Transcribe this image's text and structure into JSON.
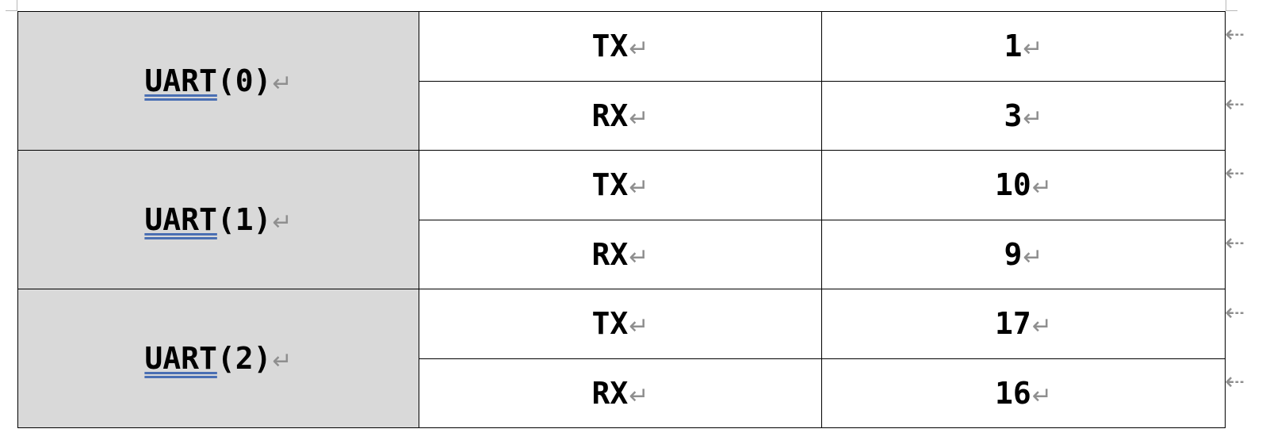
{
  "paragraph_mark": "↵",
  "table": {
    "groups": [
      {
        "prefix": "UART",
        "suffix": "(0)",
        "rows": [
          {
            "signal": "TX",
            "pin": "1"
          },
          {
            "signal": "RX",
            "pin": "3"
          }
        ]
      },
      {
        "prefix": "UART",
        "suffix": "(1)",
        "rows": [
          {
            "signal": "TX",
            "pin": "10"
          },
          {
            "signal": "RX",
            "pin": "9"
          }
        ]
      },
      {
        "prefix": "UART",
        "suffix": "(2)",
        "rows": [
          {
            "signal": "TX",
            "pin": "17"
          },
          {
            "signal": "RX",
            "pin": "16"
          }
        ]
      }
    ]
  },
  "colors": {
    "group_fill": "#d9d9d9",
    "grid": "#000000",
    "formatting_mark": "#8f8f8f",
    "spell_underline": "#4a6fb3"
  }
}
